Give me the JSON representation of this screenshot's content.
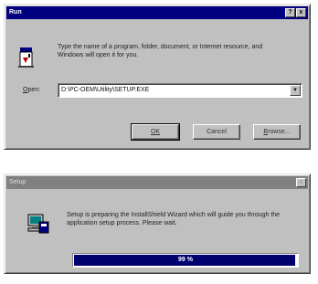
{
  "run_dialog": {
    "title": "Run",
    "help_btn": "?",
    "close_btn": "x",
    "description": "Type the name of a program, folder, document, or Internet resource, and Windows will open it for you.",
    "open_label_prefix": "",
    "open_label_u": "O",
    "open_label_rest": "pen:",
    "open_value": "D:\\PC-OEM\\Utility\\SETUP.EXE",
    "ok_label": "OK",
    "cancel_label": "Cancel",
    "browse_u": "B",
    "browse_rest": "rowse..."
  },
  "setup_dialog": {
    "title": "Setup",
    "close_btn": "x",
    "message": "Setup is preparing the InstallShield Wizard which will guide you through the application setup process. Please wait.",
    "progress_percent": 99,
    "progress_text": "99 %"
  },
  "colors": {
    "title_active": "#000080",
    "title_inactive": "#808080",
    "progress_fill": "#00006e"
  },
  "icons": {
    "run_icon": "run-program-icon",
    "setup_icon": "setup-computer-icon"
  }
}
